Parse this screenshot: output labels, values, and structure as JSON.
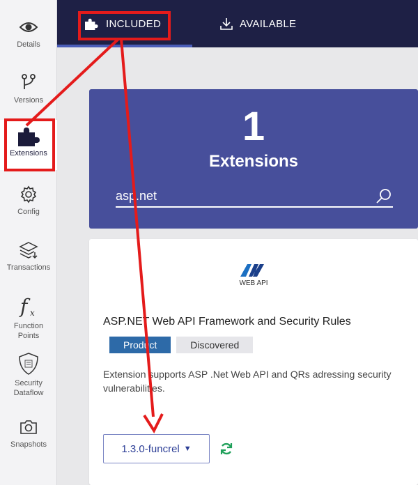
{
  "sidebar": {
    "items": [
      {
        "label": "Details",
        "icon": "eye-icon"
      },
      {
        "label": "Versions",
        "icon": "branch-icon"
      },
      {
        "label": "Extensions",
        "icon": "puzzle-icon"
      },
      {
        "label": "Config",
        "icon": "gear-icon"
      },
      {
        "label": "Transactions",
        "icon": "layers-icon"
      },
      {
        "label": "Function\nPoints",
        "icon": "function-icon"
      },
      {
        "label": "Security\nDataflow",
        "icon": "shield-icon"
      },
      {
        "label": "Snapshots",
        "icon": "camera-icon"
      }
    ]
  },
  "tabs": [
    {
      "label": "INCLUDED",
      "icon": "puzzle-icon",
      "active": true
    },
    {
      "label": "AVAILABLE",
      "icon": "download-icon",
      "active": false
    }
  ],
  "hero": {
    "count": "1",
    "title": "Extensions",
    "search_value": "asp.net"
  },
  "card": {
    "logo_text": "WEB API",
    "title": "ASP.NET Web API Framework and Security Rules",
    "badges": [
      "Product",
      "Discovered"
    ],
    "description": "Extension supports ASP .Net Web API and QRs adressing security vulnerabilities.",
    "version": "1.3.0-funcrel"
  },
  "colors": {
    "topbar": "#1e2045",
    "hero": "#474f9b",
    "annotation": "#e41b1b",
    "refresh": "#1fa05a"
  }
}
